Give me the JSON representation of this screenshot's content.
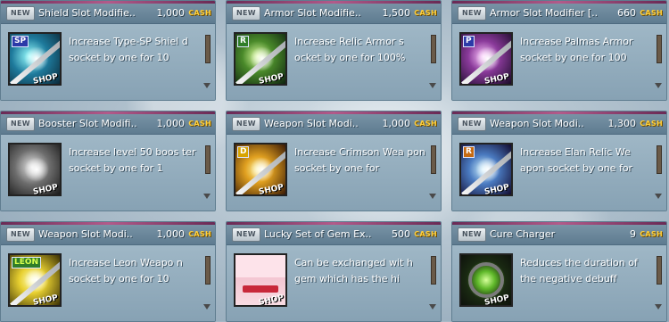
{
  "theme": {
    "cash_color": "#ffcf3a",
    "title_color": "#ffffff"
  },
  "badge_text": "NEW",
  "cash_label": "CASH",
  "shop_label": "SHOP",
  "items": [
    {
      "name": "Shield Slot Modifie..",
      "price": "1,000",
      "corner": "SP",
      "icon": "shield-sword-icon",
      "desc": "Increase Type-SP Shiel d socket by one for 10"
    },
    {
      "name": "Armor Slot Modifie..",
      "price": "1,500",
      "corner": "R",
      "icon": "green-armor-icon",
      "desc": "Increase Relic Armor s ocket by one for 100%"
    },
    {
      "name": "Armor Slot Modifier [..",
      "price": "660",
      "corner": "P",
      "icon": "purple-armor-icon",
      "desc": "Increase Palmas Armor socket by one for 100"
    },
    {
      "name": "Booster Slot Modifi..",
      "price": "1,000",
      "corner": "",
      "icon": "booster-armor-icon",
      "desc": "Increase level 50 boos ter socket by one for 1"
    },
    {
      "name": "Weapon Slot Modi..",
      "price": "1,000",
      "corner": "D",
      "icon": "crimson-weapon-icon",
      "desc": "Increase Crimson Wea pon socket by one for"
    },
    {
      "name": "Weapon Slot Modi..",
      "price": "1,300",
      "corner": "R",
      "icon": "elan-weapon-icon",
      "desc": "Increase Elan Relic We apon socket by one for"
    },
    {
      "name": "Weapon Slot Modi..",
      "price": "1,000",
      "corner": "LEON",
      "icon": "leon-weapon-icon",
      "desc": "Increase Leon Weapo n socket by one for 10"
    },
    {
      "name": "Lucky Set of Gem Ex..",
      "price": "500",
      "corner": "",
      "icon": "gem-envelope-icon",
      "desc": "Can be exchanged wit h gem which has the hi"
    },
    {
      "name": "Cure Charger",
      "price": "9",
      "corner": "",
      "icon": "cure-charger-icon",
      "desc": "Reduces the duration of the negative debuff"
    }
  ]
}
